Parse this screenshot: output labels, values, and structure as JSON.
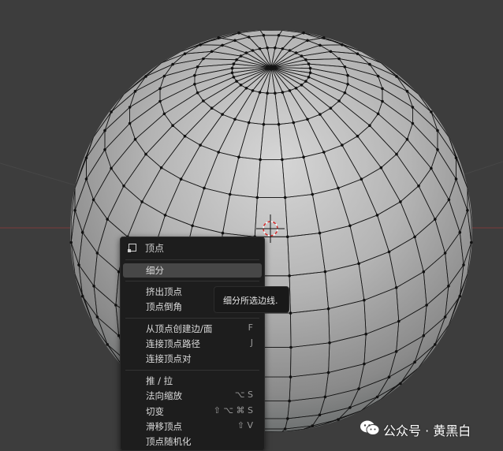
{
  "colors": {
    "background": "#3d3d3d",
    "selection": "#ff8a1f",
    "menu_bg": "#1d1d1d",
    "menu_highlight": "#474747"
  },
  "viewport": {
    "object": "UV sphere (edit mode)",
    "selection_mode": "vertex",
    "selected_faces": "2x3 faces near front-center"
  },
  "context_menu": {
    "title": "顶点",
    "title_icon": "vertex-mesh-icon",
    "items": [
      {
        "label": "细分",
        "shortcut": "",
        "active": true
      },
      {
        "label": "挤出顶点",
        "shortcut": ""
      },
      {
        "label": "顶点倒角",
        "shortcut": ""
      },
      {
        "label": "从顶点创建边/面",
        "shortcut": "F"
      },
      {
        "label": "连接顶点路径",
        "shortcut": "J"
      },
      {
        "label": "连接顶点对",
        "shortcut": ""
      },
      {
        "label": "推 / 拉",
        "shortcut": ""
      },
      {
        "label": "法向缩放",
        "shortcut": "⌥ S"
      },
      {
        "label": "切变",
        "shortcut": "⇧ ⌥ ⌘ S"
      },
      {
        "label": "滑移顶点",
        "shortcut": "⇧ V"
      },
      {
        "label": "顶点随机化",
        "shortcut": ""
      }
    ]
  },
  "tooltip": {
    "text": "细分所选边线."
  },
  "watermark": {
    "text": "公众号 · 黄黑白",
    "icon": "wechat-icon"
  }
}
